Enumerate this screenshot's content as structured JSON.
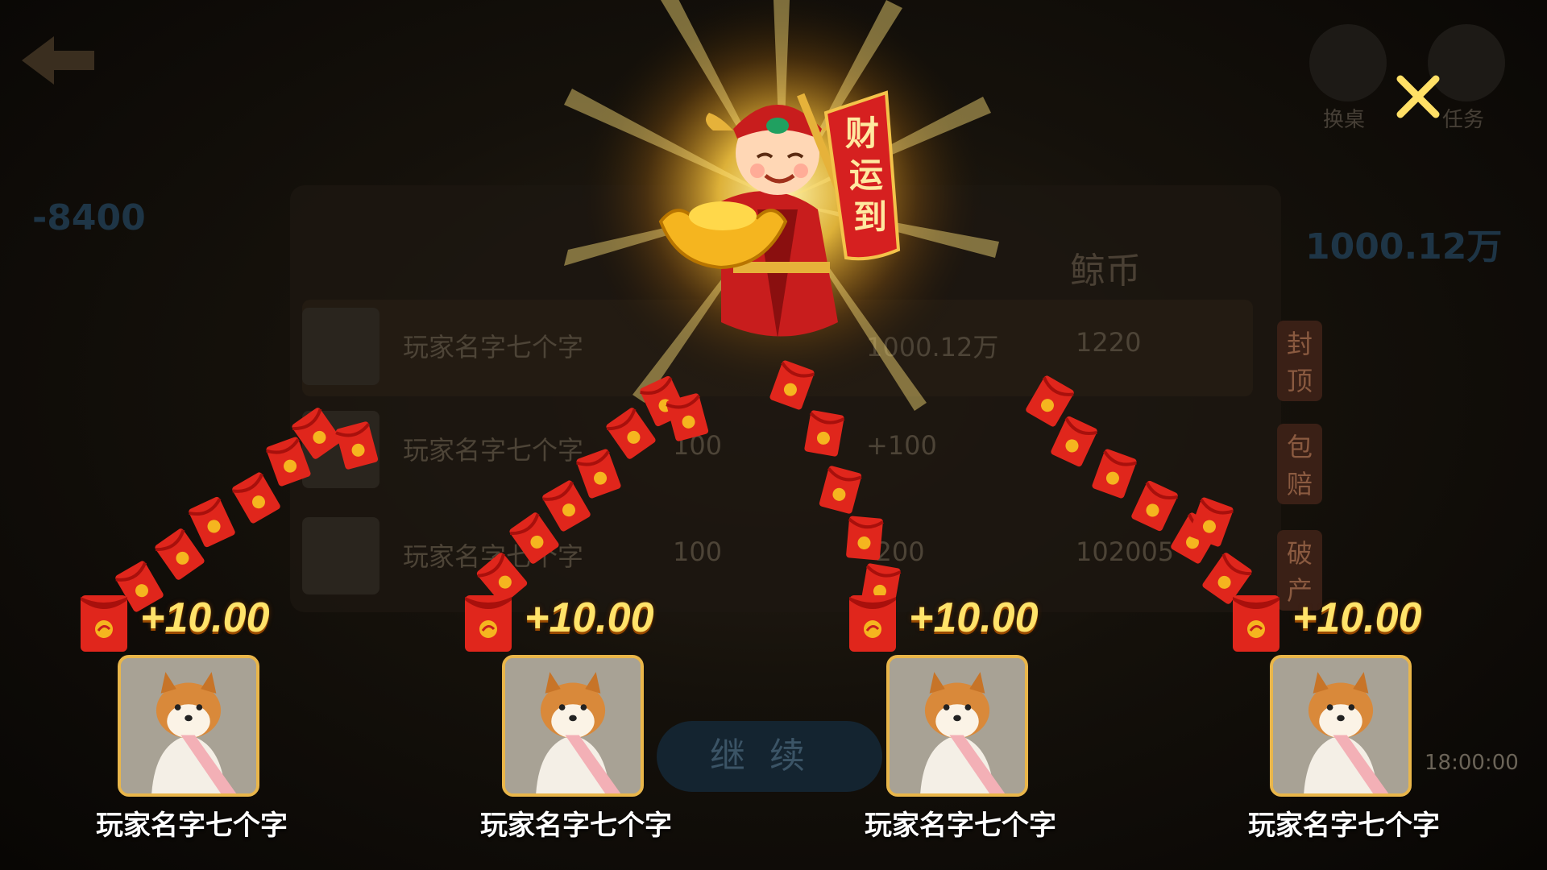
{
  "background": {
    "title": "",
    "column_header": "鲸币",
    "rows": [
      {
        "name": "玩家名字七个字",
        "c1": "",
        "c2": "1000.12万",
        "c3": "1220",
        "tag": "封顶"
      },
      {
        "name": "玩家名字七个字",
        "c1": "100",
        "c2": "+100",
        "c3": "",
        "tag": "包赔"
      },
      {
        "name": "玩家名字七个字",
        "c1": "100",
        "c2": "-200",
        "c3": "102005",
        "tag": "破产"
      }
    ],
    "continue_label": "继续",
    "time": "18:00:00",
    "left_score": "-8400",
    "right_score": "1000.12万",
    "change_table_label": "换桌",
    "task_label": "任务"
  },
  "mascot": {
    "banner_text": "财运到"
  },
  "winners": [
    {
      "amount": "+10.00",
      "name": "玩家名字七个字"
    },
    {
      "amount": "+10.00",
      "name": "玩家名字七个字"
    },
    {
      "amount": "+10.00",
      "name": "玩家名字七个字"
    },
    {
      "amount": "+10.00",
      "name": "玩家名字七个字"
    }
  ],
  "colors": {
    "envelope": "#e0261c",
    "amount": "#ffe36a",
    "avatar_border": "#e9b64a"
  },
  "icons": {
    "close": "close-icon",
    "envelope": "red-envelope-icon",
    "back": "back-arrow-icon"
  }
}
